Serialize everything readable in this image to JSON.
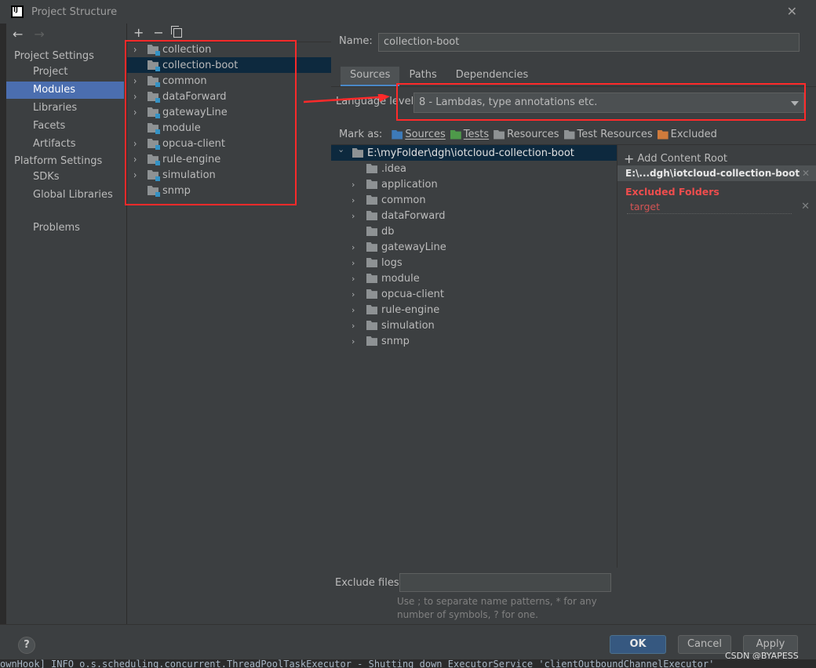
{
  "window": {
    "title": "Project Structure"
  },
  "nav": {
    "project_settings": "Project Settings",
    "items_project": [
      "Project",
      "Modules",
      "Libraries",
      "Facets",
      "Artifacts"
    ],
    "platform_settings": "Platform Settings",
    "items_platform": [
      "SDKs",
      "Global Libraries"
    ],
    "problems": "Problems",
    "selected": "Modules"
  },
  "modules": {
    "toolbar": {
      "add": "+",
      "remove": "−"
    },
    "list": [
      {
        "label": "collection",
        "expandable": true
      },
      {
        "label": "collection-boot",
        "expandable": false,
        "selected": true
      },
      {
        "label": "common",
        "expandable": true
      },
      {
        "label": "dataForward",
        "expandable": true
      },
      {
        "label": "gatewayLine",
        "expandable": true
      },
      {
        "label": "module",
        "expandable": false
      },
      {
        "label": "opcua-client",
        "expandable": true
      },
      {
        "label": "rule-engine",
        "expandable": true
      },
      {
        "label": "simulation",
        "expandable": true
      },
      {
        "label": "snmp",
        "expandable": false
      }
    ]
  },
  "detail": {
    "name_label": "Name:",
    "name_value": "collection-boot",
    "tabs": [
      "Sources",
      "Paths",
      "Dependencies"
    ],
    "active_tab": "Sources",
    "language_level_label": "Language level:",
    "language_level_value": "8 - Lambdas, type annotations etc.",
    "mark_as_label": "Mark as:",
    "mark_as": [
      {
        "label": "Sources",
        "color": "#3d7ab8"
      },
      {
        "label": "Tests",
        "color": "#4e9a4a"
      },
      {
        "label": "Resources",
        "color": "#8e9294"
      },
      {
        "label": "Test Resources",
        "color": "#8e9294"
      },
      {
        "label": "Excluded",
        "color": "#d07b3c"
      }
    ],
    "tree_root": "E:\\myFolder\\dgh\\iotcloud-collection-boot",
    "tree_children": [
      {
        "label": ".idea",
        "expandable": false
      },
      {
        "label": "application",
        "expandable": true
      },
      {
        "label": "common",
        "expandable": true
      },
      {
        "label": "dataForward",
        "expandable": true
      },
      {
        "label": "db",
        "expandable": false
      },
      {
        "label": "gatewayLine",
        "expandable": true
      },
      {
        "label": "logs",
        "expandable": true
      },
      {
        "label": "module",
        "expandable": true
      },
      {
        "label": "opcua-client",
        "expandable": true
      },
      {
        "label": "rule-engine",
        "expandable": true
      },
      {
        "label": "simulation",
        "expandable": true
      },
      {
        "label": "snmp",
        "expandable": true
      }
    ],
    "add_content_root": "Add Content Root",
    "content_root_header": "E:\\...dgh\\iotcloud-collection-boot",
    "excluded_folders_title": "Excluded Folders",
    "excluded_folders": [
      "target"
    ],
    "exclude_files_label": "Exclude files:",
    "exclude_files_value": "",
    "exclude_hint": "Use ; to separate name patterns, * for any number of symbols, ? for one."
  },
  "buttons": {
    "ok": "OK",
    "cancel": "Cancel",
    "apply": "Apply",
    "help": "?"
  },
  "watermark": "CSDN @BYAPESS",
  "console_line": "ownHook] INFO  o.s.scheduling.concurrent.ThreadPoolTaskExecutor - Shutting down ExecutorService 'clientOutboundChannelExecutor'",
  "annotation_color": "#ff2a2a"
}
